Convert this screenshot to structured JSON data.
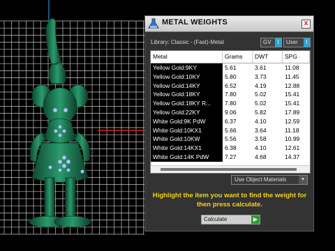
{
  "dialog": {
    "title": "METAL WEIGHTS",
    "close_glyph": "x",
    "library_label": "Library: Classic - (Fast)-Metal",
    "toggle_gv": "GV",
    "toggle_user": "User",
    "toggle_knob": "I",
    "columns": [
      "Metal",
      "Grams",
      "DWT",
      "SPG"
    ],
    "rows": [
      [
        "Yellow Gold:9KY",
        "5.61",
        "3.61",
        "11.08"
      ],
      [
        "Yellow Gold:10KY",
        "5.80",
        "3.73",
        "11.45"
      ],
      [
        "Yellow Gold:14KY",
        "6.52",
        "4.19",
        "12.88"
      ],
      [
        "Yellow Gold:18KY",
        "7.80",
        "5.02",
        "15.41"
      ],
      [
        "Yellow Gold:18KY R...",
        "7.80",
        "5.02",
        "15.41"
      ],
      [
        "Yellow Gold:22KY",
        "9.06",
        "5.82",
        "17.89"
      ],
      [
        "White Gold:9K PdW",
        "6.37",
        "4.10",
        "12.59"
      ],
      [
        "White Gold:10KX1",
        "5.66",
        "3.64",
        "11.18"
      ],
      [
        "White Gold:10KW",
        "5.56",
        "3.58",
        "10.99"
      ],
      [
        "White Gold:14KX1",
        "6.38",
        "4.10",
        "12.61"
      ],
      [
        "White Gold:14K PdW",
        "7.27",
        "4.68",
        "14.37"
      ]
    ],
    "object_materials": "Use Object Materials",
    "hint": "Highlight the item you want to find the weight for then press calculate.",
    "calculate": "Calculate"
  },
  "icons": {
    "title": "flask-icon",
    "calculate": "play-arrow-icon",
    "dropdown": "chevron-down-icon"
  },
  "colors": {
    "model_green": "#1f7a55",
    "hint_yellow": "#f6d021",
    "knob_blue": "#2aa6d6",
    "go_green": "#2f9a2f"
  }
}
